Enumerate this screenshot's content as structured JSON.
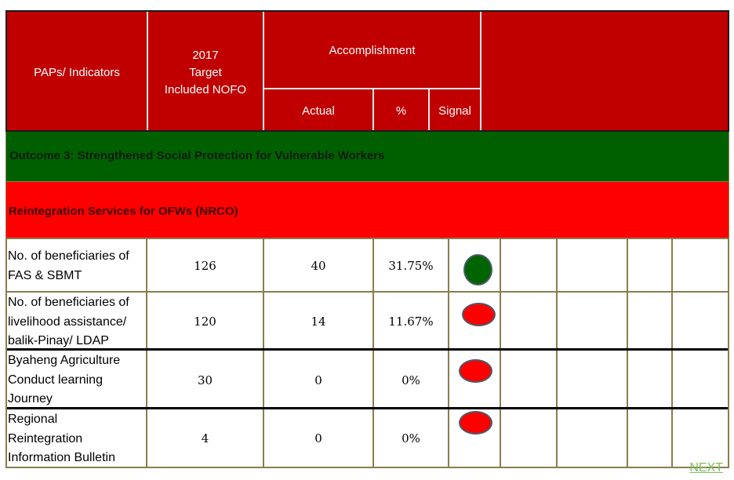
{
  "header": {
    "col_indicators": "PAPs/ Indicators",
    "col_target_line1": "2017",
    "col_target_line2": "Target",
    "col_target_line3": "Included NOFO",
    "col_accomplishment": "Accomplishment",
    "col_actual": "Actual",
    "col_percent": "%",
    "col_signal": "Signal"
  },
  "outcome": "Outcome 3: Strengthened Social Protection for Vulnerable Workers",
  "section": "Reintegration Services for OFWs (NRCO)",
  "colors": {
    "header_bg": "#c00000",
    "outcome_bg": "#006000",
    "section_bg": "#ff0000",
    "signal_green": "#006400",
    "signal_red": "#ff0000"
  },
  "rows": [
    {
      "lines": [
        "No. of beneficiaries of",
        "FAS & SBMT"
      ],
      "target": "126",
      "actual": "40",
      "percent": "31.75%",
      "signal": "green"
    },
    {
      "lines": [
        "No. of beneficiaries of",
        "livelihood assistance/",
        "balik-Pinay/ LDAP"
      ],
      "target": "120",
      "actual": "14",
      "percent": "11.67%",
      "signal": "red"
    },
    {
      "lines": [
        "Byaheng Agriculture",
        "Conduct learning",
        "Journey"
      ],
      "target": "30",
      "actual": "0",
      "percent": "0%",
      "signal": "red"
    },
    {
      "lines": [
        "Regional",
        "Reintegration",
        "Information Bulletin"
      ],
      "target": "4",
      "actual": "0",
      "percent": "0%",
      "signal": "red"
    }
  ],
  "next_link": "NEXT"
}
